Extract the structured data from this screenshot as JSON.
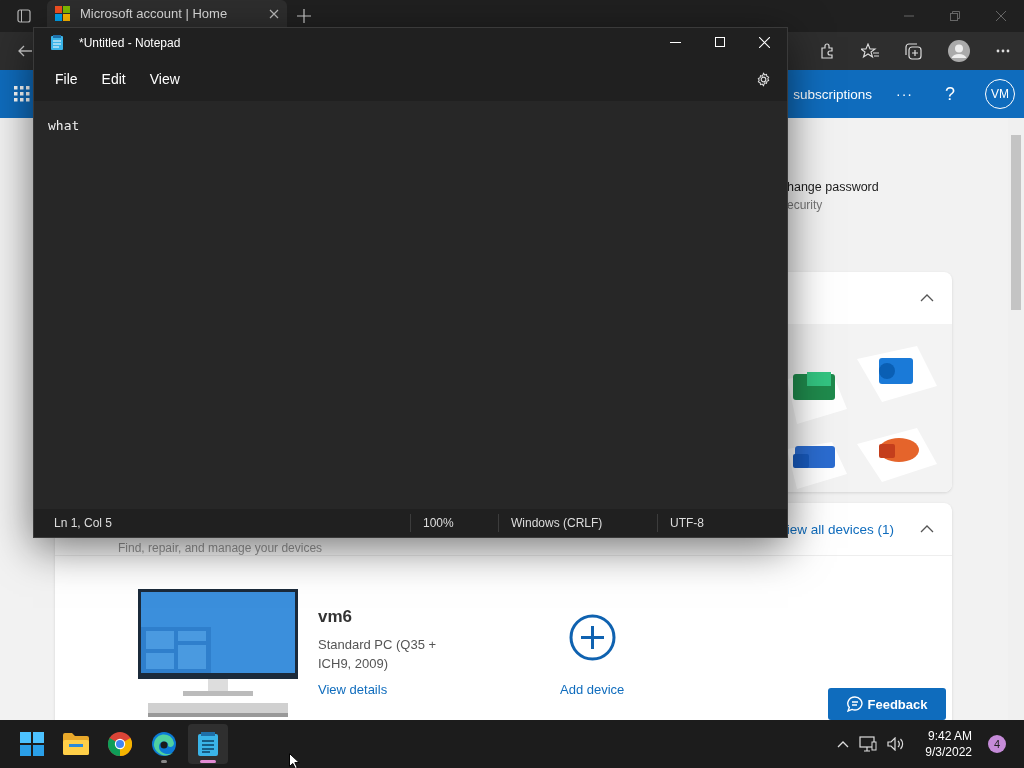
{
  "browser": {
    "tabs": [
      {
        "title": "Microsoft account | Home",
        "selected": true
      }
    ],
    "nav_bar": {
      "link": "subscriptions",
      "more": "···",
      "help": "?",
      "avatar": "VM"
    },
    "security": {
      "title": "hange password",
      "subtitle": "ecurity"
    },
    "apps_card": {
      "expanded": true
    },
    "devices_card": {
      "expanded": true,
      "subtitle": "Find, repair, and manage your devices",
      "view_all": "iew all devices (1)",
      "device": {
        "name": "vm6",
        "model": "Standard PC (Q35 + ICH9, 2009)",
        "link": "View details"
      },
      "add_device": "Add device"
    },
    "feedback": "Feedback"
  },
  "notepad": {
    "title": "*Untitled - Notepad",
    "menu": [
      "File",
      "Edit",
      "View"
    ],
    "text": "what",
    "status": [
      "Ln 1, Col 5",
      "100%",
      "Windows (CRLF)",
      "UTF-8"
    ]
  },
  "taskbar": {
    "apps": [
      {
        "kind": "start",
        "selected": false,
        "running": false
      },
      {
        "kind": "folder",
        "selected": false,
        "running": false
      },
      {
        "kind": "chrome",
        "selected": false,
        "running": false
      },
      {
        "kind": "edge",
        "selected": false,
        "running": true
      },
      {
        "kind": "notepad",
        "selected": true,
        "running": true
      }
    ],
    "time": "9:42 AM",
    "date": "9/3/2022",
    "notifications": "4"
  }
}
